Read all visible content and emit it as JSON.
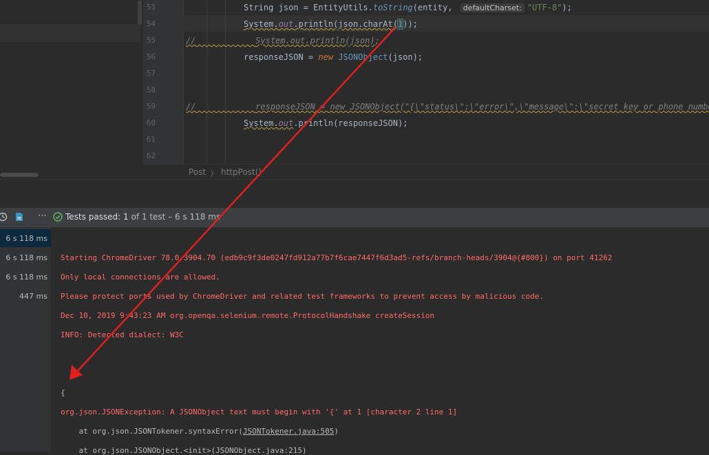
{
  "editor": {
    "line_numbers": [
      "53",
      "54",
      "55",
      "56",
      "57",
      "58",
      "59",
      "60",
      "61",
      "62"
    ],
    "lines": {
      "l53": {
        "type": "String",
        "var": " json = ",
        "cls": "EntityUtils.",
        "meth": "toString",
        "args_open": "(entity, ",
        "hint": "defaultCharset:",
        "str": "\"UTF-8\"",
        "close": ");"
      },
      "l54": {
        "obj": "System.",
        "fld": "out",
        "call": ".println(json.charAt(",
        "num": "1",
        "close": "));"
      },
      "l55": {
        "comment_prefix": "//",
        "comment": "System.out.println(json);"
      },
      "l56": {
        "lhs": "responseJSON = ",
        "kw": "new ",
        "cls": "JSONObject",
        "rest": "(json);"
      },
      "l59": {
        "comment_prefix": "//",
        "comment": "responseJSON = new JSONObject(\"{\\\"status\\\":\\\"error\\\",\\\"message\\\":\\\"secret key or phone number a"
      },
      "l60": {
        "obj": "System.",
        "fld": "out",
        "call": ".println(responseJSON);"
      }
    }
  },
  "breadcrumb": {
    "class": "Post",
    "sep": "〉",
    "method": "httpPost()"
  },
  "toolbar": {
    "status_label": "Tests passed:",
    "status_count": "1",
    "status_rest": "of 1 test – 6 s 118 ms"
  },
  "tests": {
    "times": [
      "6 s 118 ms",
      "6 s 118 ms",
      "6 s 118 ms",
      "447 ms"
    ]
  },
  "console": {
    "lines": [
      "Starting ChromeDriver 78.0.3904.70 (edb9c9f3de0247fd912a77b7f6cae7447f6d3ad5-refs/branch-heads/3904@{#800}) on port 41262",
      "Only local connections are allowed.",
      "Please protect ports used by ChromeDriver and related test frameworks to prevent access by malicious code.",
      "Dec 10, 2019 9:43:23 AM org.openqa.selenium.remote.ProtocolHandshake createSession",
      "INFO: Detected dialect: W3C",
      "{",
      "org.json.JSONException: A JSONObject text must begin with '{' at 1 [character 2 line 1]",
      "    at org.json.JSONTokener.syntaxError(",
      "JSONTokener.java:505",
      ")",
      "    at org.json.JSONObject.<init>(JSONObject.java:215)"
    ]
  },
  "colors": {
    "arrow": "#e0201a",
    "error_text": "#ff6b68",
    "accent_check": "#5fb85f"
  },
  "icons": [
    "lightbulb-icon",
    "clock-icon",
    "file-icon",
    "more-icon",
    "check-circle-icon"
  ]
}
